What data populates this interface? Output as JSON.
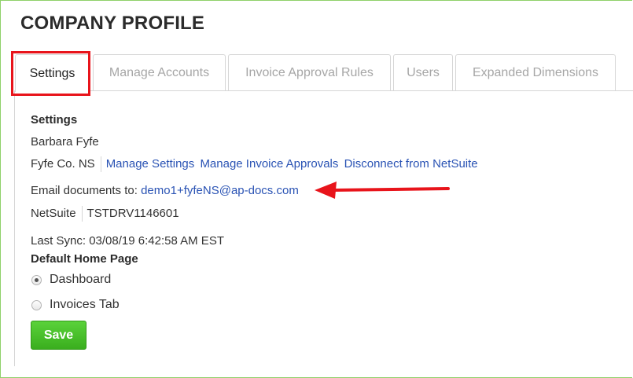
{
  "page": {
    "title": "COMPANY PROFILE"
  },
  "tabs": [
    {
      "label": "Settings",
      "active": true
    },
    {
      "label": "Manage Accounts",
      "active": false
    },
    {
      "label": "Invoice Approval Rules",
      "active": false
    },
    {
      "label": "Users",
      "active": false
    },
    {
      "label": "Expanded Dimensions",
      "active": false
    }
  ],
  "settings": {
    "heading": "Settings",
    "user_name": "Barbara Fyfe",
    "company_name": "Fyfe Co. NS",
    "links": {
      "manage_settings": "Manage Settings",
      "manage_invoice_approvals": "Manage Invoice Approvals",
      "disconnect": "Disconnect from NetSuite"
    },
    "email_label": "Email documents to:",
    "email_address": "demo1+fyfeNS@ap-docs.com",
    "integration_name": "NetSuite",
    "account_id": "TSTDRV1146601",
    "last_sync": "Last Sync: 03/08/19 6:42:58 AM EST"
  },
  "home_page": {
    "heading": "Default Home Page",
    "options": [
      {
        "label": "Dashboard",
        "selected": true
      },
      {
        "label": "Invoices Tab",
        "selected": false
      }
    ]
  },
  "actions": {
    "save_label": "Save"
  },
  "colors": {
    "highlight": "#e8141b",
    "link": "#2a53b4",
    "save_button": "#44bb26",
    "frame_border": "#8fd16a"
  },
  "icons": {
    "annotation": "red-arrow-icon",
    "radio": "radio-button-icon"
  }
}
